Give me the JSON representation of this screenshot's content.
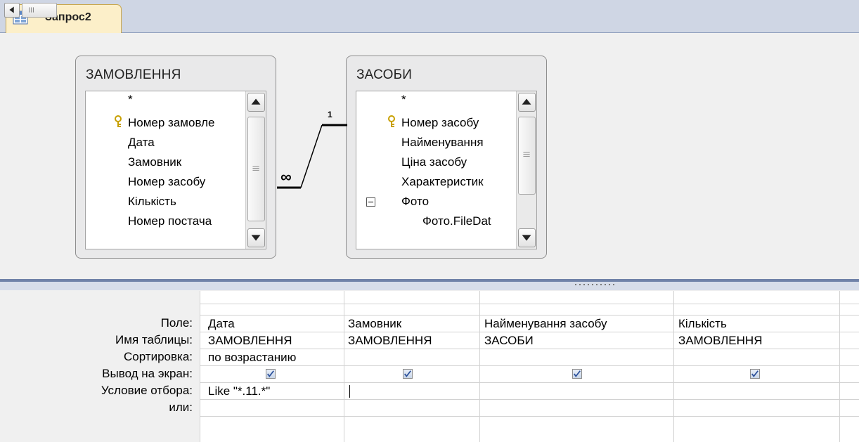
{
  "tab": {
    "title": "Запрос2"
  },
  "tables": [
    {
      "title": "ЗАМОВЛЕННЯ",
      "fields": [
        "*",
        "Номер замовле",
        "Дата",
        "Замовник",
        "Номер засобу",
        "Кількість",
        "Номер постача"
      ]
    },
    {
      "title": "ЗАСОБИ",
      "fields": [
        "*",
        "Номер засобу",
        "Найменування",
        "Ціна засобу",
        "Характеристик",
        "Фото",
        "Фото.FileDat"
      ]
    }
  ],
  "relationship": {
    "one_label": "1",
    "many_label": "∞"
  },
  "grid": {
    "row_labels": [
      "Поле:",
      "Имя таблицы:",
      "Сортировка:",
      "Вывод на экран:",
      "Условие отбора:",
      "или:"
    ],
    "columns": [
      {
        "field": "Дата",
        "table": "ЗАМОВЛЕННЯ",
        "sort": "по возрастанию",
        "show": true,
        "criteria": "Like \"*.11.*\""
      },
      {
        "field": "Замовник",
        "table": "ЗАМОВЛЕННЯ",
        "sort": "",
        "show": true,
        "criteria": ""
      },
      {
        "field": "Найменування засобу",
        "table": "ЗАСОБИ",
        "sort": "",
        "show": true,
        "criteria": ""
      },
      {
        "field": "Кількість",
        "table": "ЗАМОВЛЕННЯ",
        "sort": "",
        "show": true,
        "criteria": ""
      }
    ]
  }
}
